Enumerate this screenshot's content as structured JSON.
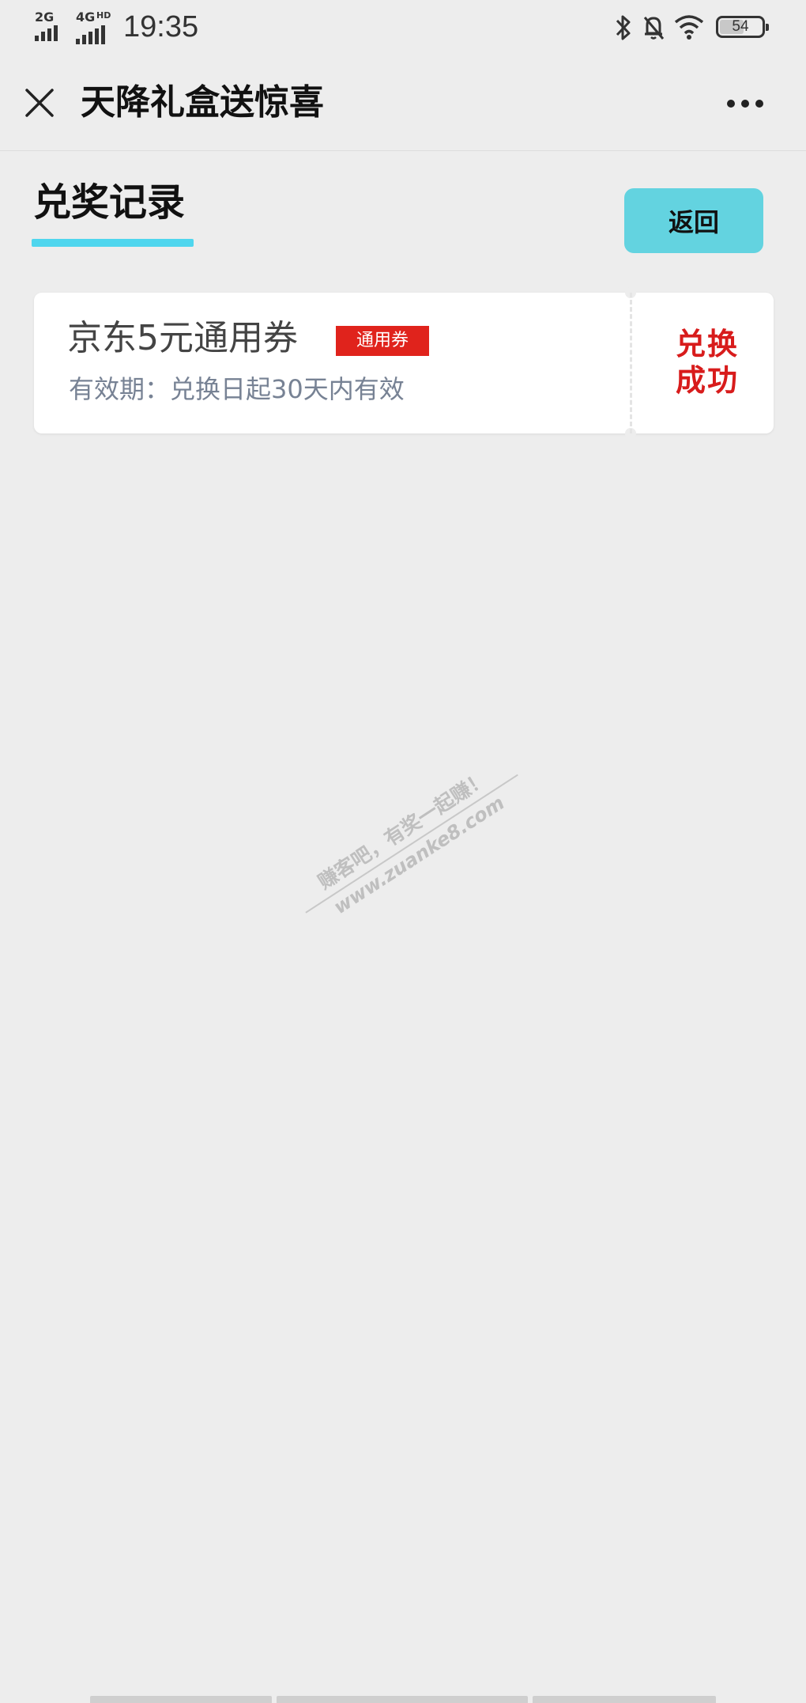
{
  "status_bar": {
    "signal1_label": "2G",
    "signal2_label": "4G",
    "signal2_sup": "HD",
    "time": "19:35",
    "battery_level": "54",
    "icons": [
      "bluetooth-icon",
      "mute-bell-icon",
      "wifi-icon",
      "battery-icon"
    ]
  },
  "nav": {
    "title": "天降礼盒送惊喜",
    "close_icon": "close-icon",
    "more_icon": "more-dots-icon"
  },
  "section": {
    "title": "兑奖记录",
    "back_label": "返回",
    "accent_color": "#4fd6ee",
    "button_color": "#63d3e0"
  },
  "coupons": [
    {
      "name": "京东5元通用券",
      "tag": "通用券",
      "validity": "有效期：兑换日起30天内有效",
      "status_line1": "兑换",
      "status_line2": "成功",
      "status_color": "#d81c1c"
    }
  ],
  "watermark": {
    "line1": "赚客吧，有奖一起赚！",
    "line2": "www.zuanke8.com"
  }
}
